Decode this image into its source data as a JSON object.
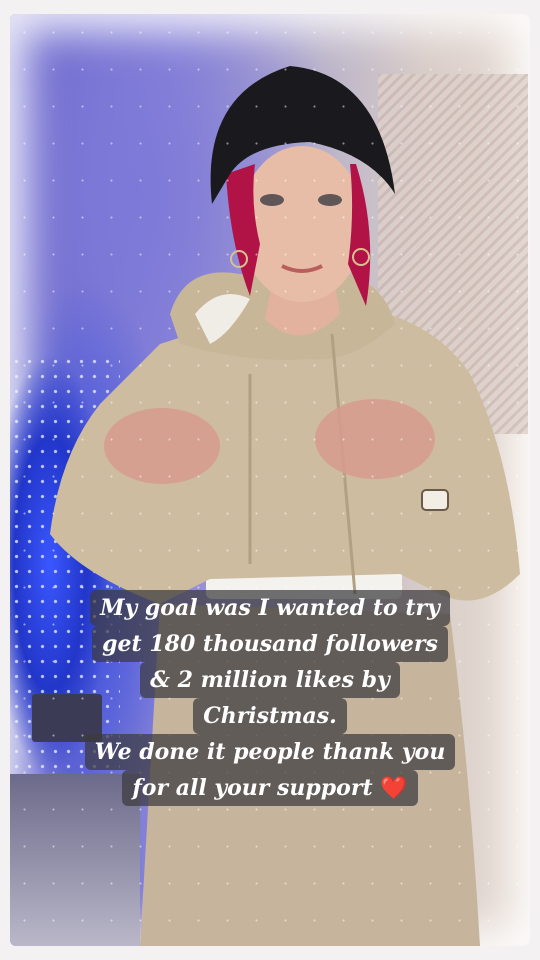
{
  "caption": {
    "line1": "My goal was I wanted to try",
    "line2": "get 180 thousand followers",
    "line3": "& 2 million likes by",
    "line4": "Christmas.",
    "line5": "We done it people thank you",
    "line6": "for all your support",
    "emoji": "❤️"
  },
  "colors": {
    "background": "#f3f1f2",
    "caption_bg": "#3c3a3e",
    "caption_text": "#ffffff",
    "heart": "#e1202f"
  }
}
